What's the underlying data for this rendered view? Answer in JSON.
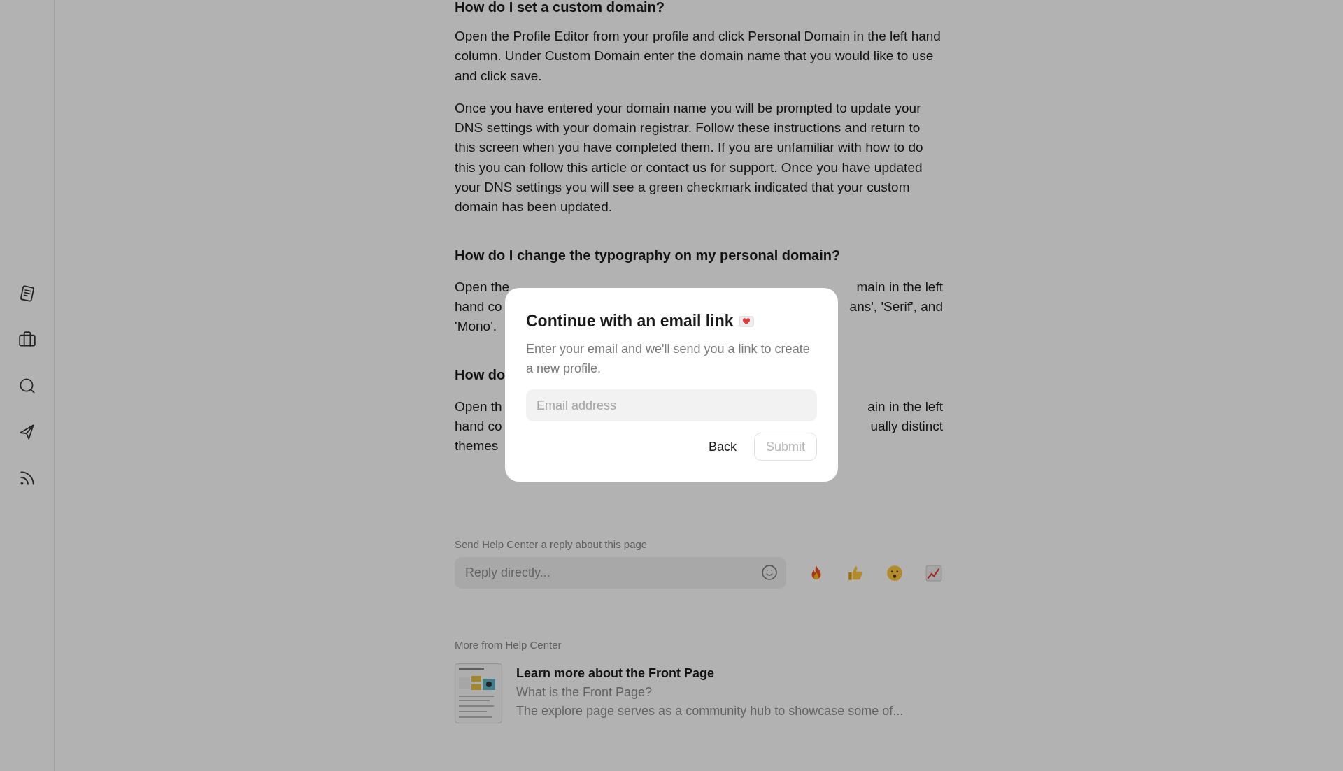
{
  "sidebar": {
    "items": [
      {
        "kind": "notes"
      },
      {
        "kind": "briefcase"
      },
      {
        "kind": "search"
      },
      {
        "kind": "send"
      },
      {
        "kind": "feed"
      }
    ]
  },
  "article": {
    "blocks": [
      {
        "kind": "cut_heading",
        "text": "How do I set a custom domain?"
      },
      {
        "kind": "paragraph",
        "text": "Open the Profile Editor from your profile and click Personal Domain in the left hand column. Under Custom Domain enter the domain name that you would like to use and click save."
      },
      {
        "kind": "paragraph",
        "text": "Once you have entered your domain name you will be prompted to update your DNS settings with your domain registrar. Follow these instructions and return to this screen when you have completed them. If you are unfamiliar with how to do this you can follow this article or contact us for support. Once you have updated your DNS settings you will see a green checkmark indicated that your custom domain has been updated."
      },
      {
        "kind": "heading",
        "text": "How do I change the typography on my personal domain?"
      },
      {
        "kind": "partial_paragraph",
        "lines": [
          {
            "left": "Open the",
            "right": "main in the left"
          },
          {
            "left": "hand co",
            "right": "ans', 'Serif', and"
          },
          {
            "left": "'Mono'."
          }
        ]
      },
      {
        "kind": "heading",
        "text": "How do"
      },
      {
        "kind": "partial_paragraph",
        "lines": [
          {
            "left": "Open th",
            "right": "ain in the left"
          },
          {
            "left": "hand co",
            "right": "ually distinct"
          },
          {
            "left": "themes"
          }
        ]
      }
    ]
  },
  "reply": {
    "label": "Send Help Center a reply about this page",
    "placeholder": "Reply directly...",
    "reactions": [
      {
        "kind": "fire"
      },
      {
        "kind": "thumbs_up"
      },
      {
        "kind": "surprised"
      },
      {
        "kind": "chart"
      }
    ]
  },
  "more": {
    "label": "More from Help Center",
    "cards": [
      {
        "title": "Learn more about the Front Page",
        "subtitle": "What is the Front Page?",
        "excerpt": "The explore page serves as a community hub to showcase some of..."
      }
    ]
  },
  "modal": {
    "title": "Continue with an email link",
    "description": "Enter your email and we'll send you a link to create a new profile.",
    "email": {
      "placeholder": "Email address"
    },
    "buttons": [
      {
        "label": "Back",
        "kind": "text",
        "disabled": false
      },
      {
        "label": "Submit",
        "kind": "outline",
        "disabled": true
      }
    ]
  }
}
